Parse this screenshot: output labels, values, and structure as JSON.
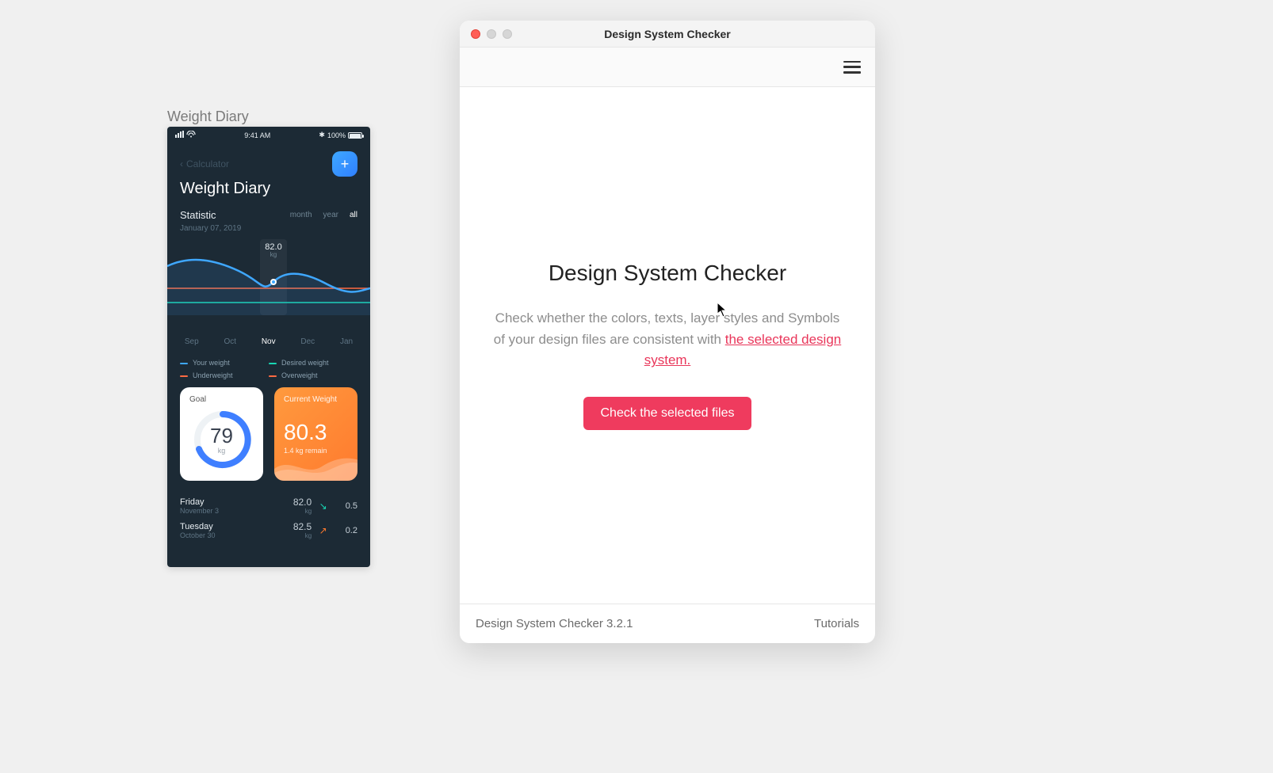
{
  "artboard": {
    "label": "Weight Diary"
  },
  "phone": {
    "statusbar": {
      "time": "9:41 AM",
      "battery_pct": "100%"
    },
    "nav": {
      "back_label": "Calculator",
      "add_icon": "plus-icon"
    },
    "title": "Weight Diary",
    "stat_section": {
      "label": "Statistic",
      "date": "January 07, 2019",
      "tabs": {
        "month": "month",
        "year": "year",
        "all": "all"
      },
      "active_tab": "all"
    },
    "chart": {
      "tooltip_value": "82.0",
      "tooltip_unit": "kg",
      "months": [
        "Sep",
        "Oct",
        "Nov",
        "Dec",
        "Jan"
      ],
      "active_month": "Nov"
    },
    "legend": {
      "your": "Your weight",
      "desired": "Desired weight",
      "under": "Underweight",
      "over": "Overweight"
    },
    "cards": {
      "goal": {
        "label": "Goal",
        "value": "79",
        "unit": "kg"
      },
      "current": {
        "label": "Current Weight",
        "value": "80.3",
        "subtext": "1.4 kg remain"
      }
    },
    "rows": [
      {
        "day": "Friday",
        "date": "November 3",
        "value": "82.0",
        "unit": "kg",
        "dir": "down",
        "delta": "0.5"
      },
      {
        "day": "Tuesday",
        "date": "October 30",
        "value": "82.5",
        "unit": "kg",
        "dir": "up",
        "delta": "0.2"
      }
    ]
  },
  "app": {
    "window_title": "Design System Checker",
    "menu_icon": "hamburger-icon",
    "main": {
      "heading": "Design System Checker",
      "desc_prefix": "Check whether the colors, texts, layer styles and Symbols of your design files are consistent with ",
      "desc_link": "the selected design system.",
      "action_label": "Check the selected files"
    },
    "footer": {
      "version": "Design System Checker 3.2.1",
      "tutorials": "Tutorials"
    }
  }
}
